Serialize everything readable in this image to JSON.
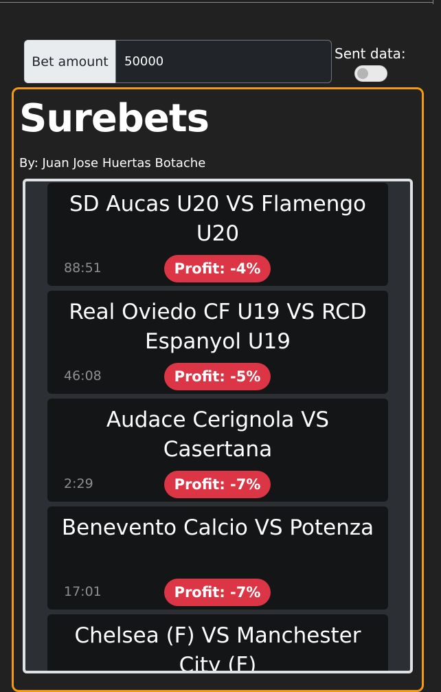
{
  "controls": {
    "bet_label": "Bet amount",
    "bet_value": "50000",
    "sent_label": "Sent data:",
    "sent_enabled": false
  },
  "header": {
    "title": "Surebets",
    "author": "By: Juan Jose Huertas Botache"
  },
  "colors": {
    "panel_border": "#f39c12",
    "badge": "#dc3545",
    "card": "#141517",
    "background": "#212121"
  },
  "surebets": [
    {
      "match": "SD Aucas U20 VS Flamengo U20",
      "time": "88:51",
      "profit": "Profit: -4%"
    },
    {
      "match": "Real Oviedo CF U19 VS RCD Espanyol U19",
      "time": "46:08",
      "profit": "Profit: -5%"
    },
    {
      "match": "Audace Cerignola VS Casertana",
      "time": "2:29",
      "profit": "Profit: -7%"
    },
    {
      "match": "Benevento Calcio VS Potenza",
      "time": "17:01",
      "profit": "Profit: -7%"
    },
    {
      "match": "Chelsea (F) VS Manchester City (F)",
      "time": "",
      "profit": ""
    }
  ]
}
